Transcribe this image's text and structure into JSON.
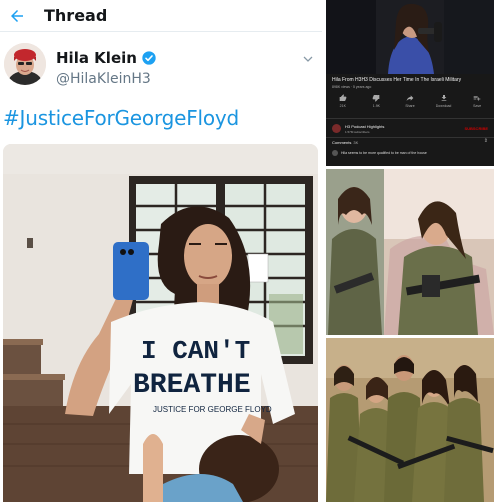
{
  "header": {
    "title": "Thread"
  },
  "tweet": {
    "author_name": "Hila Klein",
    "handle": "@HilaKleinH3",
    "text": "#JusticeForGeorgeFloyd",
    "shirt_text_line1": "I CAN'T",
    "shirt_text_line2": "BREATHE",
    "shirt_text_line3": "JUSTICE FOR GEORGE FLOYD"
  },
  "youtube": {
    "title": "Hila From H3H3 Discusses Her Time In The Israeli Military",
    "meta": "898K views · 5 years ago",
    "actions": [
      {
        "label": "21K",
        "icon": "thumbs-up-icon"
      },
      {
        "label": "1.9K",
        "icon": "thumbs-down-icon"
      },
      {
        "label": "Share",
        "icon": "share-icon"
      },
      {
        "label": "Download",
        "icon": "download-icon"
      },
      {
        "label": "Save",
        "icon": "save-icon"
      }
    ],
    "channel_name": "H3 Podcast Highlights",
    "channel_subs": "1.57M subscribers",
    "subscribe_label": "SUBSCRIBE",
    "comments_label": "Comments",
    "comments_count": "3K",
    "comment_text": "Hila seems to be more qualified to be man of the house"
  },
  "colors": {
    "twitter_blue": "#1da1f2",
    "hashtag_blue": "#1b95e0",
    "youtube_red": "#cc0000"
  }
}
